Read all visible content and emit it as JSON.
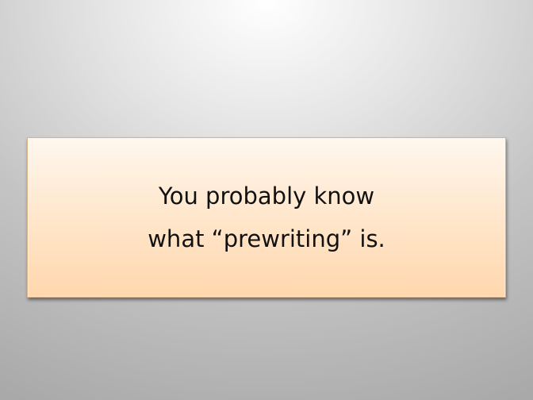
{
  "slide": {
    "lines": [
      "You probably know",
      "what “prewriting” is."
    ]
  }
}
